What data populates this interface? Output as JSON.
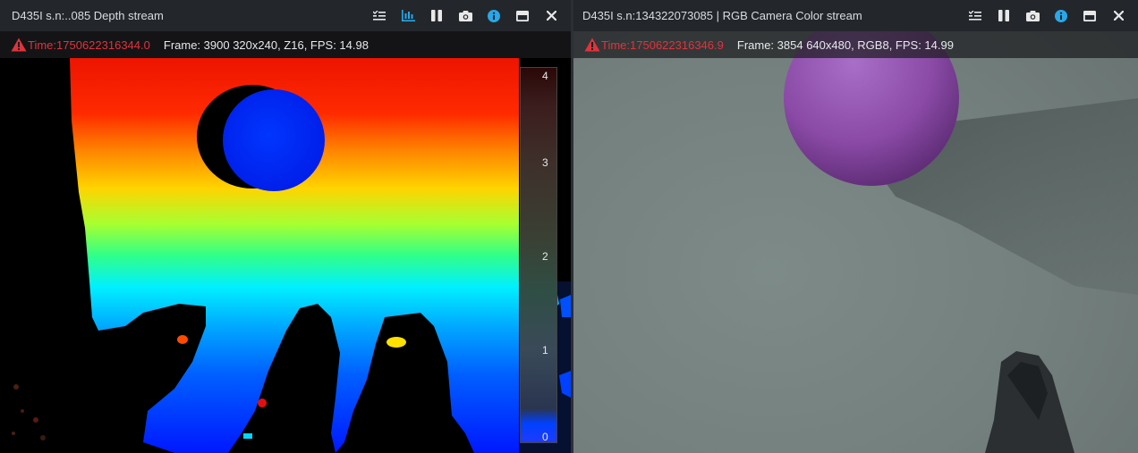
{
  "depth_stream": {
    "title": "D435I s.n:..085 Depth stream",
    "time_label": "Time: ",
    "time_value": "1750622316344.0",
    "frame_info": "Frame: 3900  320x240,  Z16,   FPS:   14.98",
    "toolbar_icons": [
      "controls-icon",
      "histogram-icon",
      "pause-icon",
      "snapshot-icon",
      "info-icon",
      "minimize-icon",
      "close-icon"
    ],
    "colorbar_ticks": [
      "4",
      "3",
      "2",
      "1",
      "0"
    ]
  },
  "color_stream": {
    "title": "D435I s.n:134322073085 | RGB Camera Color stream",
    "time_label": "Time: ",
    "time_value": "1750622316346.9",
    "frame_info": "Frame: 3854  640x480,  RGB8,   FPS:   14.99",
    "toolbar_icons": [
      "controls-icon",
      "pause-icon",
      "snapshot-icon",
      "info-icon",
      "minimize-icon",
      "close-icon"
    ]
  },
  "colors": {
    "accent_blue": "#29a7e8",
    "warning_red": "#e0333b",
    "titlebar_bg": "#23272c"
  }
}
